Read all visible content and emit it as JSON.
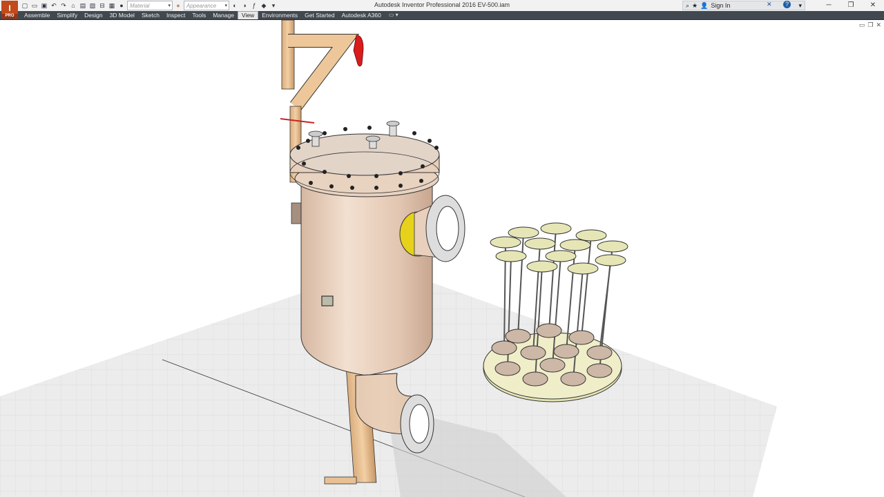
{
  "window": {
    "title": "Autodesk Inventor Professional 2016    EV-500.iam"
  },
  "app": {
    "logo_letter": "I",
    "logo_badge": "PRO"
  },
  "qat": {
    "material_placeholder": "Material",
    "appearance_placeholder": "Appearance"
  },
  "signin": {
    "label": "Sign In"
  },
  "ribbon": {
    "tabs": [
      "Assemble",
      "Simplify",
      "Design",
      "3D Model",
      "Sketch",
      "Inspect",
      "Tools",
      "Manage",
      "View",
      "Environments",
      "Get Started",
      "Autodesk A360"
    ],
    "active_tab": "View"
  },
  "colors": {
    "vessel": "#e8cdb8",
    "pipe": "#e8c093",
    "flange_accent": "#e6d21a",
    "valve_handle": "#d91c1c",
    "filter_disk": "#e6e5b6",
    "grid_floor": "#ededed"
  }
}
